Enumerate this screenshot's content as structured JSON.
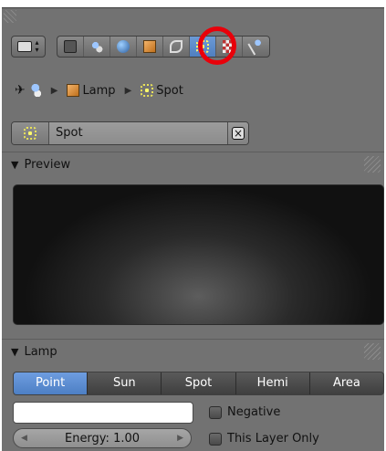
{
  "breadcrumb": {
    "items": [
      {
        "label": "Lamp",
        "icon": "lamp-object-icon"
      },
      {
        "label": "Spot",
        "icon": "spot-lamp-icon"
      }
    ]
  },
  "context_tabs": [
    {
      "icon": "render-camera-icon",
      "active": false
    },
    {
      "icon": "render-layers-icon",
      "active": false
    },
    {
      "icon": "world-icon",
      "active": false
    },
    {
      "icon": "object-icon",
      "active": false
    },
    {
      "icon": "constraints-icon",
      "active": false
    },
    {
      "icon": "lamp-data-icon",
      "active": true
    },
    {
      "icon": "texture-icon",
      "active": false
    },
    {
      "icon": "particles-icon",
      "active": false
    }
  ],
  "datablock": {
    "name": "Spot",
    "close_label": "⊠"
  },
  "panels": {
    "preview": {
      "title": "Preview"
    },
    "lamp": {
      "title": "Lamp"
    }
  },
  "lamp_types": [
    "Point",
    "Sun",
    "Spot",
    "Hemi",
    "Area"
  ],
  "lamp_type_selected": "Point",
  "energy": {
    "label": "Energy: 1.00"
  },
  "checkboxes": [
    {
      "label": "Negative",
      "checked": false
    },
    {
      "label": "This Layer Only",
      "checked": false
    }
  ],
  "colors": {
    "accent": "#5b8ad0",
    "highlight_ring": "#e8000a",
    "panel_bg": "#727272"
  }
}
